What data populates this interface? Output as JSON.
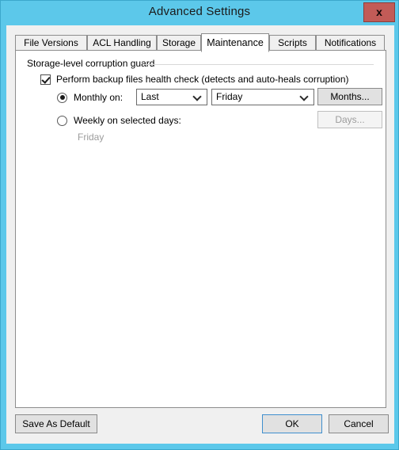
{
  "window": {
    "title": "Advanced Settings",
    "close_label": "x",
    "title_bar_color": "#5cc8ea",
    "close_button_color": "#c25b57",
    "body_color": "#f0f0f0"
  },
  "tabs": [
    {
      "label": "File Versions",
      "active": false
    },
    {
      "label": "ACL Handling",
      "active": false
    },
    {
      "label": "Storage",
      "active": false
    },
    {
      "label": "Maintenance",
      "active": true
    },
    {
      "label": "Scripts",
      "active": false
    },
    {
      "label": "Notifications",
      "active": false
    }
  ],
  "maintenance": {
    "group_title": "Storage-level corruption guard",
    "health_check": {
      "label": "Perform backup files health check (detects and auto-heals corruption)",
      "checked": true
    },
    "monthly": {
      "label": "Monthly on:",
      "selected": true,
      "week_combo": {
        "value": "Last",
        "arrow": "chevron-down-icon"
      },
      "day_combo": {
        "value": "Friday",
        "arrow": "chevron-down-icon"
      },
      "button": {
        "label": "Months...",
        "enabled": true
      }
    },
    "weekly": {
      "label": "Weekly on selected days:",
      "selected": false,
      "value": "Friday",
      "button": {
        "label": "Days...",
        "enabled": false
      }
    }
  },
  "footer": {
    "save_as_default_label": "Save As Default",
    "ok_label": "OK",
    "cancel_label": "Cancel",
    "focus_color": "#3f8fce"
  }
}
